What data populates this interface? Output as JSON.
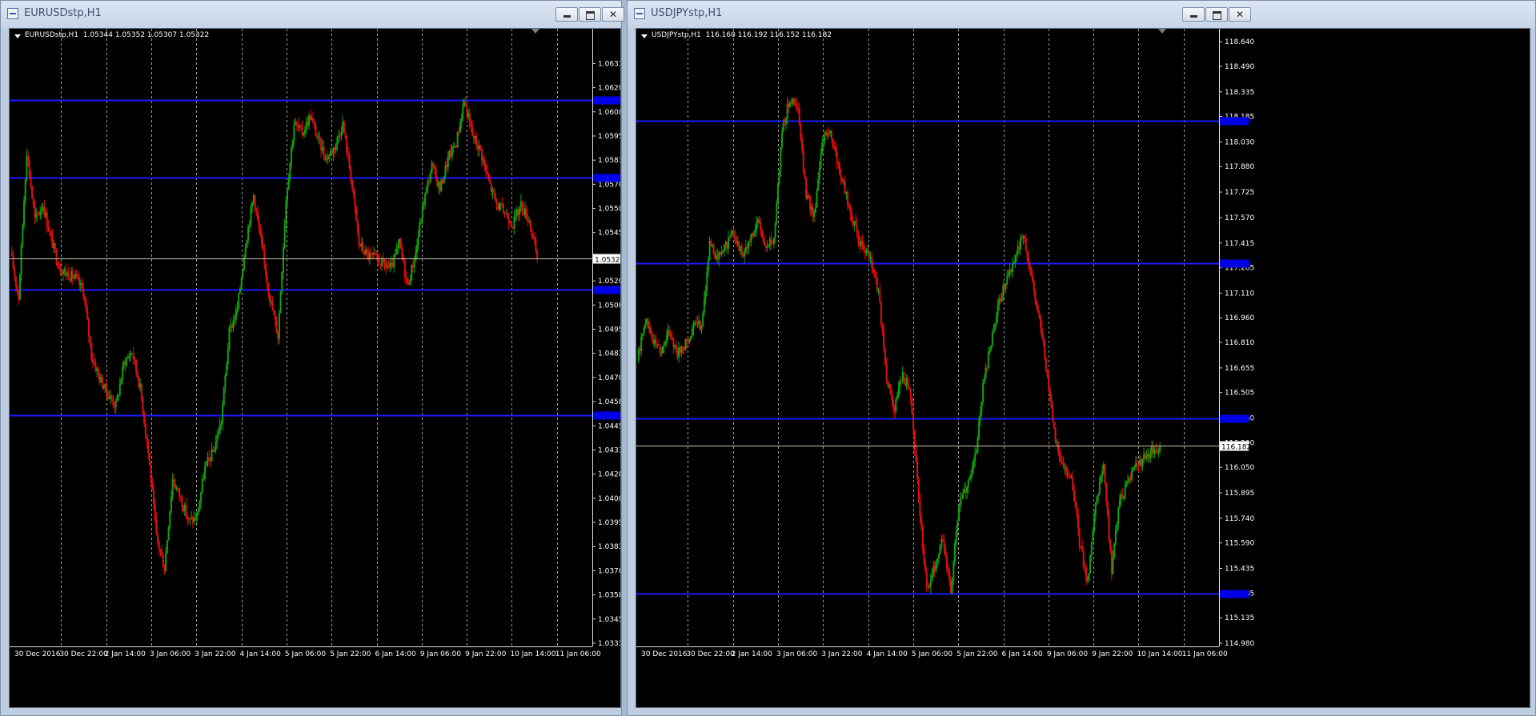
{
  "windows": [
    {
      "title": "EURUSDstp,H1",
      "chart_info": "EURUSDstp,H1  1.05344 1.05352 1.05307 1.05322",
      "chart_data": {
        "type": "candlestick",
        "symbol": "EURUSDstp",
        "timeframe": "H1",
        "ohlc": {
          "open": 1.05344,
          "high": 1.05352,
          "low": 1.05307,
          "close": 1.05322
        },
        "current_price": 1.05322,
        "ylim": [
          1.0333,
          1.0646
        ],
        "price_ticks": [
          "1.06330",
          "1.06205",
          "1.06080",
          "1.05955",
          "1.05830",
          "1.05705",
          "1.05580",
          "1.05455",
          "1.05330",
          "1.05205",
          "1.05080",
          "1.04955",
          "1.04830",
          "1.04705",
          "1.04580",
          "1.04455",
          "1.04330",
          "1.04205",
          "1.04080",
          "1.03955",
          "1.03830",
          "1.03705",
          "1.03580",
          "1.03455",
          "1.03330"
        ],
        "time_labels": [
          "30 Dec 2016",
          "30 Dec 22:00",
          "2 Jan 14:00",
          "3 Jan 06:00",
          "3 Jan 22:00",
          "4 Jan 14:00",
          "5 Jan 06:00",
          "5 Jan 22:00",
          "6 Jan 14:00",
          "9 Jan 06:00",
          "9 Jan 22:00",
          "10 Jan 14:00",
          "11 Jan 06:00"
        ],
        "horizontal_levels": [
          1.0614,
          1.0574,
          1.0516,
          1.0451
        ],
        "path": [
          1.0535,
          1.0512,
          1.0588,
          1.0552,
          1.056,
          1.0542,
          1.0528,
          1.0524,
          1.0522,
          1.0515,
          1.0482,
          1.047,
          1.0462,
          1.0456,
          1.0478,
          1.0484,
          1.0465,
          1.0432,
          1.0388,
          1.0372,
          1.0418,
          1.0408,
          1.0396,
          1.0398,
          1.0424,
          1.0432,
          1.0448,
          1.0494,
          1.0506,
          1.054,
          1.0565,
          1.0538,
          1.0512,
          1.0492,
          1.0563,
          1.0602,
          1.0597,
          1.0606,
          1.0593,
          1.0584,
          1.059,
          1.0602,
          1.0575,
          1.054,
          1.0534,
          1.0532,
          1.0529,
          1.0527,
          1.054,
          1.0518,
          1.0535,
          1.0562,
          1.058,
          1.0568,
          1.0584,
          1.0592,
          1.0614,
          1.0596,
          1.0588,
          1.0572,
          1.056,
          1.0556,
          1.055,
          1.056,
          1.0552,
          1.0532
        ]
      },
      "level_tags": [
        "1.06140",
        "1.05740",
        "1.05160",
        "1.04510"
      ],
      "current_tag": "1.05322"
    },
    {
      "title": "USDJPYstp,H1",
      "chart_info": "USDJPYstp,H1  116.160 116.192 116.152 116.182",
      "chart_data": {
        "type": "candlestick",
        "symbol": "USDJPYstp",
        "timeframe": "H1",
        "ohlc": {
          "open": 116.16,
          "high": 116.192,
          "low": 116.152,
          "close": 116.182
        },
        "current_price": 116.182,
        "ylim": [
          114.98,
          118.66
        ],
        "price_ticks": [
          "118.640",
          "118.490",
          "118.335",
          "118.185",
          "118.030",
          "117.880",
          "117.725",
          "117.570",
          "117.415",
          "117.265",
          "117.110",
          "116.960",
          "116.810",
          "116.655",
          "116.505",
          "116.350",
          "116.200",
          "116.050",
          "115.895",
          "115.740",
          "115.590",
          "115.435",
          "115.285",
          "115.135",
          "114.980"
        ],
        "time_labels": [
          "30 Dec 2016",
          "30 Dec 22:00",
          "2 Jan 14:00",
          "3 Jan 06:00",
          "3 Jan 22:00",
          "4 Jan 14:00",
          "5 Jan 06:00",
          "5 Jan 22:00",
          "6 Jan 14:00",
          "9 Jan 06:00",
          "9 Jan 22:00",
          "10 Jan 14:00",
          "11 Jan 06:00"
        ],
        "horizontal_levels": [
          118.16,
          117.29,
          116.35,
          115.28
        ],
        "path": [
          116.7,
          116.95,
          116.82,
          116.76,
          116.88,
          116.74,
          116.8,
          116.9,
          116.92,
          117.4,
          117.32,
          117.4,
          117.48,
          117.35,
          117.42,
          117.55,
          117.38,
          117.45,
          118.1,
          118.3,
          118.22,
          117.7,
          117.58,
          118.05,
          118.1,
          117.88,
          117.7,
          117.52,
          117.38,
          117.31,
          117.12,
          116.58,
          116.42,
          116.62,
          116.5,
          115.85,
          115.3,
          115.45,
          115.62,
          115.3,
          115.82,
          115.95,
          116.1,
          116.55,
          116.8,
          117.05,
          117.22,
          117.32,
          117.48,
          117.22,
          116.96,
          116.6,
          116.2,
          116.05,
          116.0,
          115.6,
          115.35,
          115.85,
          116.05,
          115.42,
          115.85,
          115.95,
          116.05,
          116.1,
          116.15,
          116.182
        ]
      },
      "level_tags": [
        "118.160",
        "117.290",
        "116.350",
        "115.280"
      ],
      "current_tag": "116.182"
    }
  ],
  "colors": {
    "background": "#000000",
    "bull_candle": "#13a10e",
    "bear_candle": "#e20f0f",
    "grid": "#9a9a9a",
    "level_line": "#1a1aff",
    "price_line": "#c8c8aa",
    "axis_text": "#ffffff"
  },
  "icons": [
    "chart-window-icon",
    "minimize-icon",
    "maximize-icon",
    "close-icon",
    "dropdown-triangle-icon",
    "chart-shift-icon"
  ]
}
